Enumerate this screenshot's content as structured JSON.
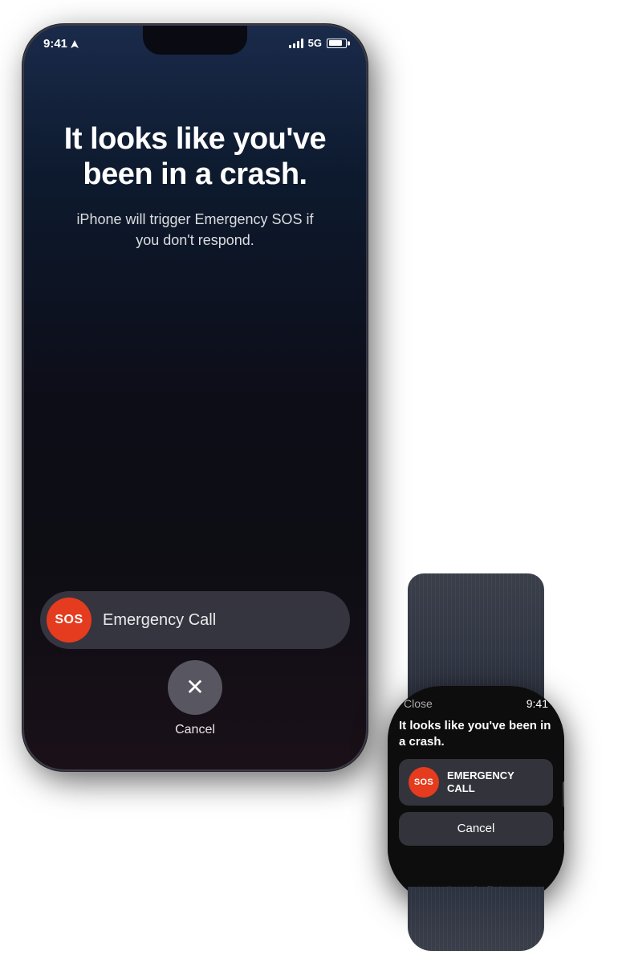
{
  "scene": {
    "background": "#ffffff"
  },
  "iphone": {
    "status_bar": {
      "time": "9:41",
      "signal": "5G",
      "location_icon": "▶"
    },
    "screen": {
      "title": "It looks like you've been in a crash.",
      "subtitle": "iPhone will trigger Emergency SOS if you don't respond.",
      "sos_label": "Emergency Call",
      "sos_badge": "SOS",
      "cancel_label": "Cancel"
    }
  },
  "apple_watch": {
    "status_bar": {
      "close_label": "Close",
      "time": "9:41"
    },
    "screen": {
      "title": "It looks like you've been in a crash.",
      "sos_badge": "SOS",
      "sos_label": "EMERGENCY CALL",
      "cancel_label": "Cancel",
      "footer": "Apple Watch will trigger"
    }
  }
}
